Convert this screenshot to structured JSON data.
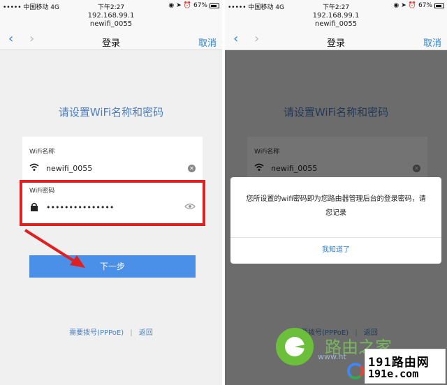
{
  "status": {
    "carrier": "••••• 中国移动  4G",
    "time": "下午2:27",
    "battery": "67%",
    "icons": [
      "lock-rotation-icon",
      "location-icon",
      "alarm-icon"
    ]
  },
  "nav": {
    "url_line1": "192.168.99.1",
    "url_line2": "newifi_0055",
    "title": "登录",
    "cancel_label": "取消",
    "back_glyph": "‹",
    "forward_glyph": "›"
  },
  "form": {
    "heading": "请设置WiFi名称和密码",
    "wifi_name_label": "WiFi名称",
    "wifi_name_value": "newifi_0055",
    "wifi_password_label": "WiFi密码",
    "wifi_password_value": "•••••••••••••••",
    "next_label": "下一步"
  },
  "links": {
    "pppoe": "需要拨号(PPPoE)",
    "separator": "|",
    "back": "返回"
  },
  "dialog": {
    "message": "您所设置的wifi密码即为您路由器管理后台的登录密码，请您记录",
    "ok_label": "我知道了"
  },
  "watermark": {
    "brand": "路由之家",
    "site_line1": "191路由网",
    "site_line2": "191e.com",
    "sub": "www.ht"
  },
  "colors": {
    "accent": "#2a7fd4",
    "button": "#4a8fe8",
    "highlight": "#e02020",
    "heading": "#4a7ec0"
  }
}
